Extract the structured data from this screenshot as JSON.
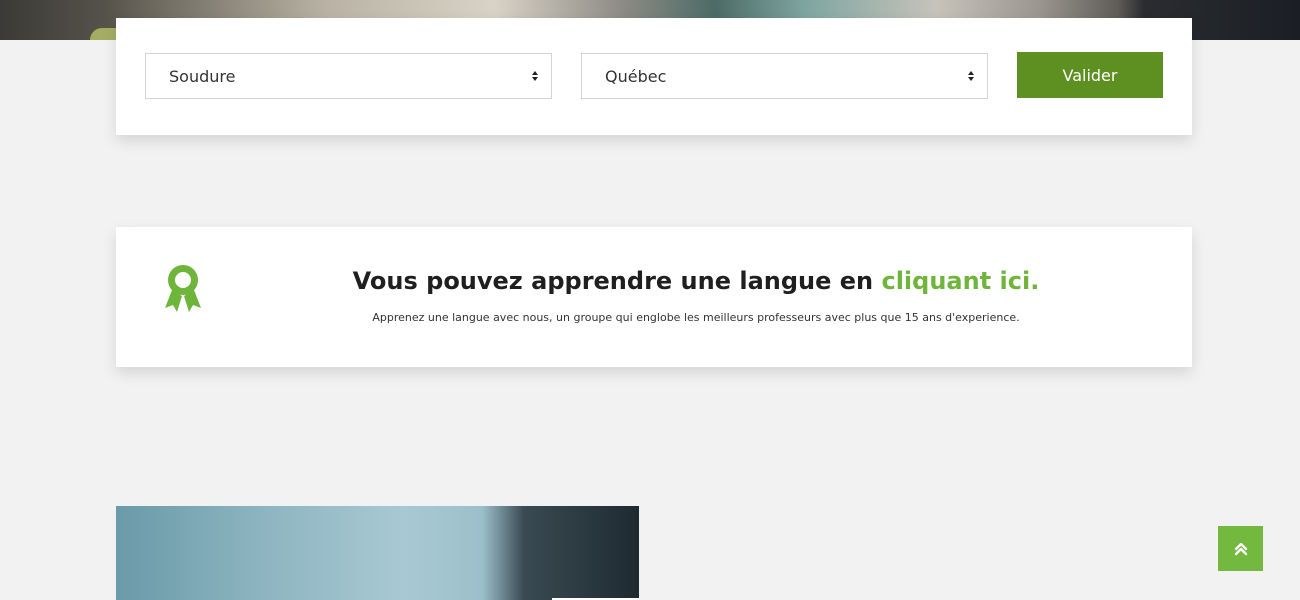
{
  "search": {
    "field_select": "Soudure",
    "region_select": "Québec",
    "submit_label": "Valider"
  },
  "banner": {
    "title_prefix": "Vous pouvez apprendre une langue en",
    "title_link": "cliquant ici.",
    "subtitle": "Apprenez une langue avec nous, un groupe qui englobe les meilleurs professeurs avec plus que 15 ans d'experience.",
    "icon": "award-ribbon-icon"
  },
  "scroll_top": {
    "icon": "double-chevron-up-icon"
  },
  "colors": {
    "accent_green": "#6fb53b",
    "button_green": "#5e8f21",
    "page_bg": "#f2f2f2"
  }
}
